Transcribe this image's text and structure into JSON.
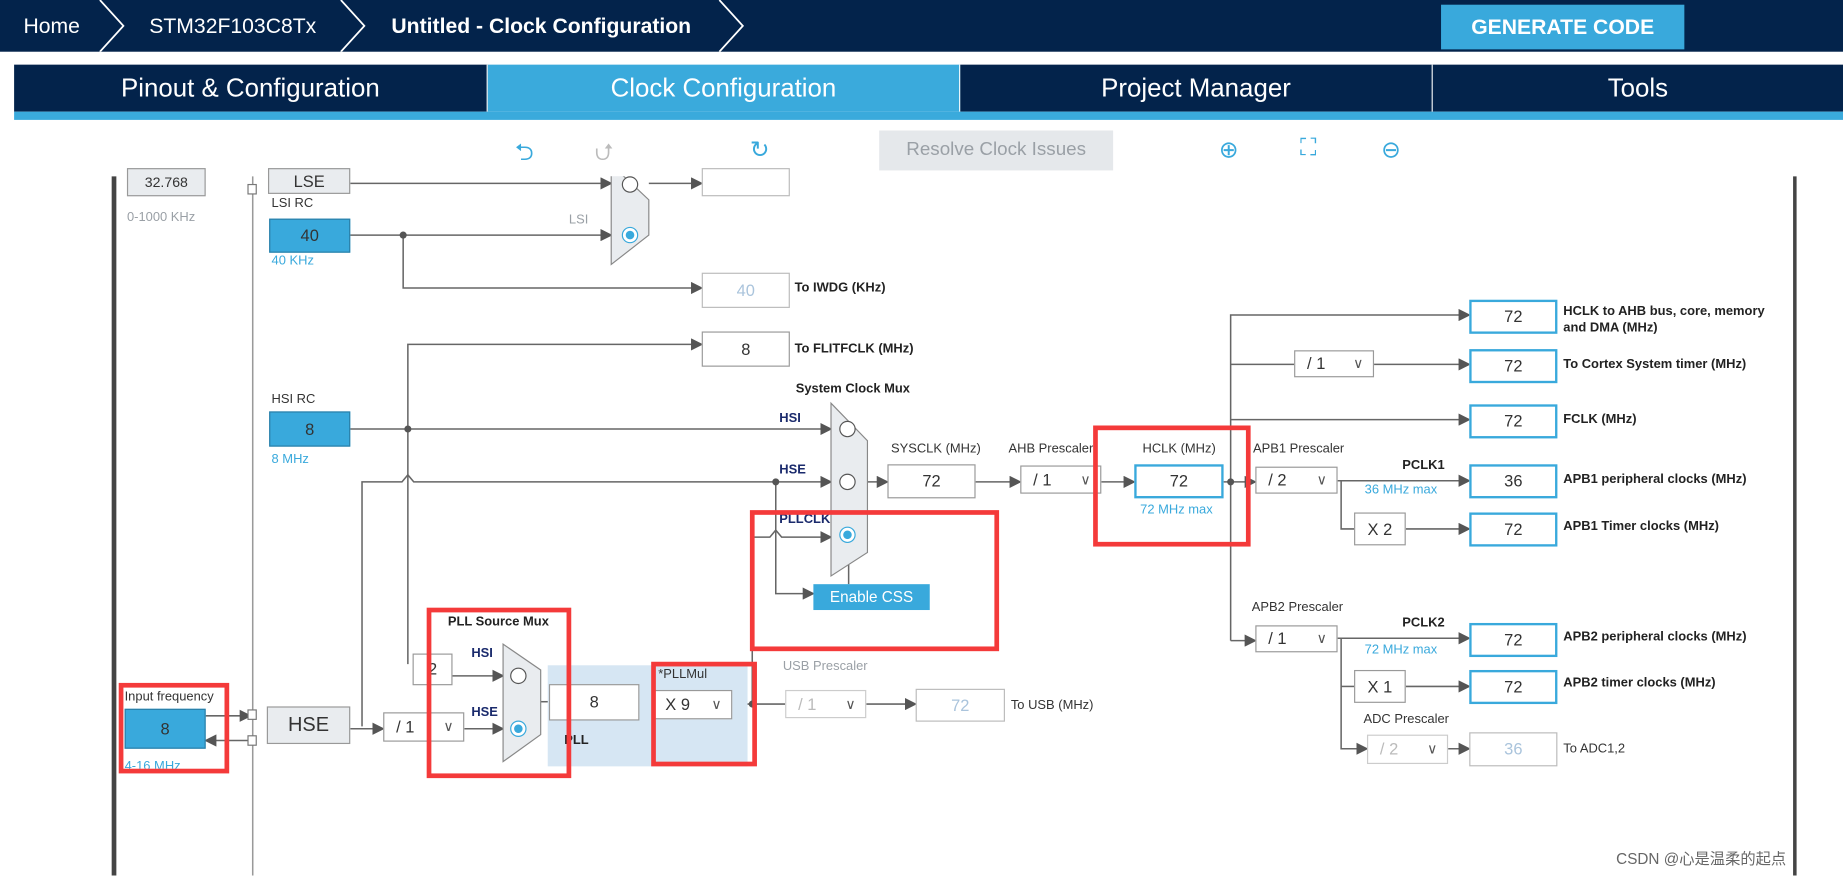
{
  "header": {
    "breadcrumb": [
      "Home",
      "STM32F103C8Tx",
      "Untitled - Clock Configuration"
    ],
    "generate_label": "GENERATE CODE"
  },
  "tabs": [
    {
      "label": "Pinout & Configuration"
    },
    {
      "label": "Clock Configuration",
      "active": true
    },
    {
      "label": "Project Manager"
    },
    {
      "label": "Tools"
    }
  ],
  "toolbar": {
    "resolve_label": "Resolve Clock Issues",
    "icons": [
      "undo-icon",
      "redo-icon",
      "refresh-icon",
      "zoom-in-icon",
      "fit-screen-icon",
      "zoom-out-icon"
    ]
  },
  "colors": {
    "brand": "#03234b",
    "accent": "#39a9dc",
    "highlight": "#f43a3a"
  },
  "diagram": {
    "lse": {
      "value": "32.768",
      "range": "0-1000 KHz",
      "label": "LSE"
    },
    "lsi": {
      "label": "LSI RC",
      "value": "40",
      "unit": "40 KHz",
      "mux_input": "LSI"
    },
    "iwdg": {
      "value": "40",
      "label": "To IWDG (KHz)"
    },
    "flitfclk": {
      "value": "8",
      "label": "To FLITFCLK (MHz)"
    },
    "hsi": {
      "label": "HSI RC",
      "value": "8",
      "unit": "8 MHz"
    },
    "sysmux": {
      "label": "System Clock Mux",
      "inputs": [
        "HSI",
        "HSE",
        "PLLCLK"
      ],
      "selected": "PLLCLK"
    },
    "css_label": "Enable CSS",
    "sysclk": {
      "label": "SYSCLK (MHz)",
      "value": "72"
    },
    "ahb": {
      "label": "AHB Prescaler",
      "value": "/ 1"
    },
    "hclk": {
      "label": "HCLK (MHz)",
      "value": "72",
      "max": "72 MHz max"
    },
    "outputs": {
      "ahb": {
        "value": "72",
        "label": "HCLK to AHB bus, core, memory and DMA (MHz)"
      },
      "cortex_div": "/ 1",
      "cortex": {
        "value": "72",
        "label": "To Cortex System timer (MHz)"
      },
      "fclk": {
        "value": "72",
        "label": "FCLK (MHz)"
      },
      "apb1_prescaler_label": "APB1 Prescaler",
      "apb1_div": "/ 2",
      "pclk1": "PCLK1",
      "pclk1_max": "36 MHz max",
      "apb1_periph": {
        "value": "36",
        "label": "APB1 peripheral clocks (MHz)"
      },
      "apb1_mult": "X 2",
      "apb1_timer": {
        "value": "72",
        "label": "APB1 Timer clocks (MHz)"
      },
      "apb2_prescaler_label": "APB2 Prescaler",
      "apb2_div": "/ 1",
      "pclk2": "PCLK2",
      "pclk2_max": "72 MHz max",
      "apb2_periph": {
        "value": "72",
        "label": "APB2 peripheral clocks (MHz)"
      },
      "apb2_mult": "X 1",
      "apb2_timer": {
        "value": "72",
        "label": "APB2 timer clocks (MHz)"
      },
      "adc_prescaler_label": "ADC Prescaler",
      "adc_div": "/ 2",
      "adc": {
        "value": "36",
        "label": "To ADC1,2"
      }
    },
    "pllsrc": {
      "label": "PLL Source Mux",
      "hsi_div": "2",
      "inputs": [
        "HSI",
        "HSE"
      ],
      "selected": "HSE"
    },
    "pll": {
      "label": "PLL",
      "value": "8",
      "mul_label": "*PLLMul",
      "mul": "X 9"
    },
    "usb": {
      "label": "USB Prescaler",
      "div": "/ 1",
      "value": "72",
      "out_label": "To USB (MHz)"
    },
    "hse": {
      "label": "HSE",
      "div": "/ 1",
      "input_label": "Input frequency",
      "input_value": "8",
      "range": "4-16 MHz"
    }
  },
  "watermark": "CSDN @心是温柔的起点"
}
